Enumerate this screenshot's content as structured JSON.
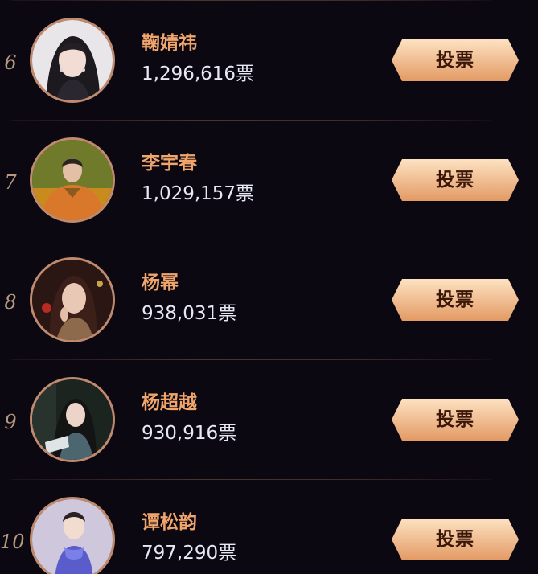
{
  "vote_button_label": "投票",
  "colors": {
    "background": "#0c0812",
    "name": "#f0a56c",
    "votes": "#e6e9f3",
    "rank": "#b39a80",
    "button_top": "#fde2c2",
    "button_bottom": "#e39a64",
    "button_text": "#3a1608"
  },
  "entries": [
    {
      "rank": "6",
      "name": "鞠婧祎",
      "votes": "1,296,616票",
      "avatar_icon": "portrait-photo"
    },
    {
      "rank": "7",
      "name": "李宇春",
      "votes": "1,029,157票",
      "avatar_icon": "portrait-photo"
    },
    {
      "rank": "8",
      "name": "杨幂",
      "votes": "938,031票",
      "avatar_icon": "portrait-photo"
    },
    {
      "rank": "9",
      "name": "杨超越",
      "votes": "930,916票",
      "avatar_icon": "portrait-photo"
    },
    {
      "rank": "10",
      "name": "谭松韵",
      "votes": "797,290票",
      "avatar_icon": "portrait-photo"
    }
  ]
}
